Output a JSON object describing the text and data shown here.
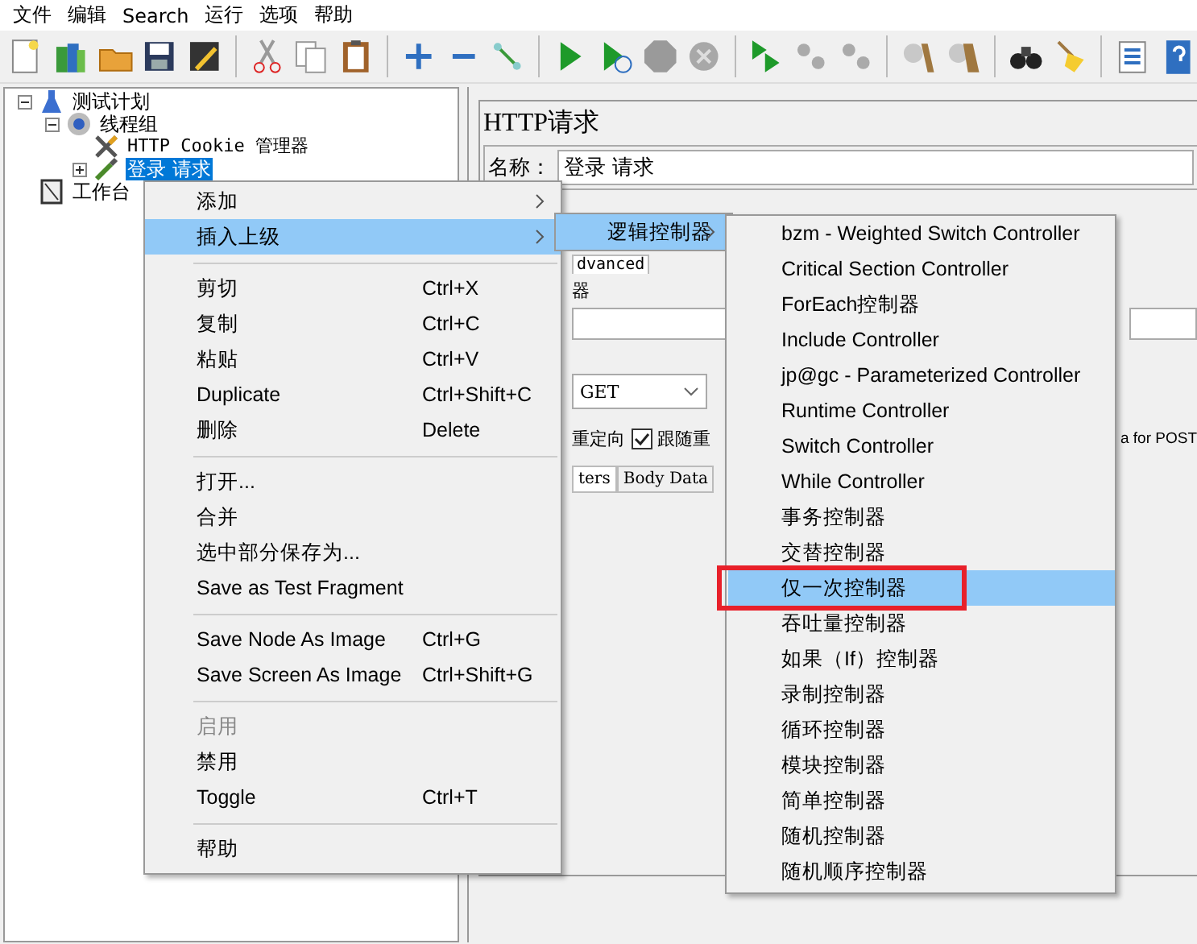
{
  "menu_bar": [
    "文件",
    "编辑",
    "Search",
    "运行",
    "选项",
    "帮助"
  ],
  "tree": [
    {
      "label": "测试计划",
      "kind": "plan",
      "expanded": true,
      "selected": false,
      "children": [
        {
          "label": "线程组",
          "kind": "threads",
          "expanded": true,
          "selected": false,
          "children": [
            {
              "label": "HTTP Cookie 管理器",
              "kind": "config",
              "selected": false
            },
            {
              "label": "登录 请求",
              "kind": "sampler",
              "expanded": false,
              "selected": true
            }
          ]
        }
      ]
    },
    {
      "label": "工作台",
      "kind": "workbench",
      "selected": false
    }
  ],
  "editor": {
    "title": "HTTP请求",
    "name_label": "名称：",
    "name_value": "登录 请求",
    "tab_fragment": "dvanced",
    "section_fragment": "器",
    "method": "GET",
    "redirect_fragment": "重定向",
    "follow_redirects": {
      "label": "跟随重",
      "checked": true
    },
    "tabs": [
      {
        "label": "ters",
        "selected": true
      },
      {
        "label": "Body Data",
        "selected": false
      }
    ],
    "post_fragment": "a for POST"
  },
  "context_menu": [
    {
      "kind": "item",
      "label": "添加",
      "submenu": true,
      "selected": false
    },
    {
      "kind": "item",
      "label": "插入上级",
      "submenu": true,
      "selected": true
    },
    {
      "kind": "separator"
    },
    {
      "kind": "item",
      "label": "剪切",
      "shortcut": "Ctrl+X",
      "selected": false
    },
    {
      "kind": "item",
      "label": "复制",
      "shortcut": "Ctrl+C",
      "selected": false
    },
    {
      "kind": "item",
      "label": "粘贴",
      "shortcut": "Ctrl+V",
      "selected": false
    },
    {
      "kind": "item",
      "label": "Duplicate",
      "shortcut": "Ctrl+Shift+C",
      "selected": false
    },
    {
      "kind": "item",
      "label": "删除",
      "shortcut": "Delete",
      "selected": false
    },
    {
      "kind": "separator"
    },
    {
      "kind": "item",
      "label": "打开...",
      "selected": false
    },
    {
      "kind": "item",
      "label": "合并",
      "selected": false
    },
    {
      "kind": "item",
      "label": "选中部分保存为...",
      "selected": false
    },
    {
      "kind": "item",
      "label": "Save as Test Fragment",
      "selected": false
    },
    {
      "kind": "separator"
    },
    {
      "kind": "item",
      "label": "Save Node As Image",
      "shortcut": "Ctrl+G",
      "selected": false
    },
    {
      "kind": "item",
      "label": "Save Screen As Image",
      "shortcut": "Ctrl+Shift+G",
      "selected": false
    },
    {
      "kind": "separator"
    },
    {
      "kind": "item",
      "label": "启用",
      "disabled": true,
      "selected": false
    },
    {
      "kind": "item",
      "label": "禁用",
      "selected": false
    },
    {
      "kind": "item",
      "label": "Toggle",
      "shortcut": "Ctrl+T",
      "selected": false
    },
    {
      "kind": "separator"
    },
    {
      "kind": "item",
      "label": "帮助",
      "selected": false
    }
  ],
  "insert_parent_menu": [
    {
      "label": "逻辑控制器",
      "submenu": true,
      "selected": true
    }
  ],
  "logic_controller_menu": [
    {
      "label": "bzm - Weighted Switch Controller",
      "selected": false,
      "outlined": false
    },
    {
      "label": "Critical Section Controller",
      "selected": false,
      "outlined": false
    },
    {
      "label": "ForEach控制器",
      "selected": false,
      "outlined": false
    },
    {
      "label": "Include Controller",
      "selected": false,
      "outlined": false
    },
    {
      "label": "jp@gc - Parameterized Controller",
      "selected": false,
      "outlined": false
    },
    {
      "label": "Runtime Controller",
      "selected": false,
      "outlined": false
    },
    {
      "label": "Switch Controller",
      "selected": false,
      "outlined": false
    },
    {
      "label": "While Controller",
      "selected": false,
      "outlined": false
    },
    {
      "label": "事务控制器",
      "selected": false,
      "outlined": false
    },
    {
      "label": "交替控制器",
      "selected": false,
      "outlined": false
    },
    {
      "label": "仅一次控制器",
      "selected": true,
      "outlined": true
    },
    {
      "label": "吞吐量控制器",
      "selected": false,
      "outlined": false
    },
    {
      "label": "如果（If）控制器",
      "selected": false,
      "outlined": false
    },
    {
      "label": "录制控制器",
      "selected": false,
      "outlined": false
    },
    {
      "label": "循环控制器",
      "selected": false,
      "outlined": false
    },
    {
      "label": "模块控制器",
      "selected": false,
      "outlined": false
    },
    {
      "label": "简单控制器",
      "selected": false,
      "outlined": false
    },
    {
      "label": "随机控制器",
      "selected": false,
      "outlined": false
    },
    {
      "label": "随机顺序控制器",
      "selected": false,
      "outlined": false
    }
  ]
}
